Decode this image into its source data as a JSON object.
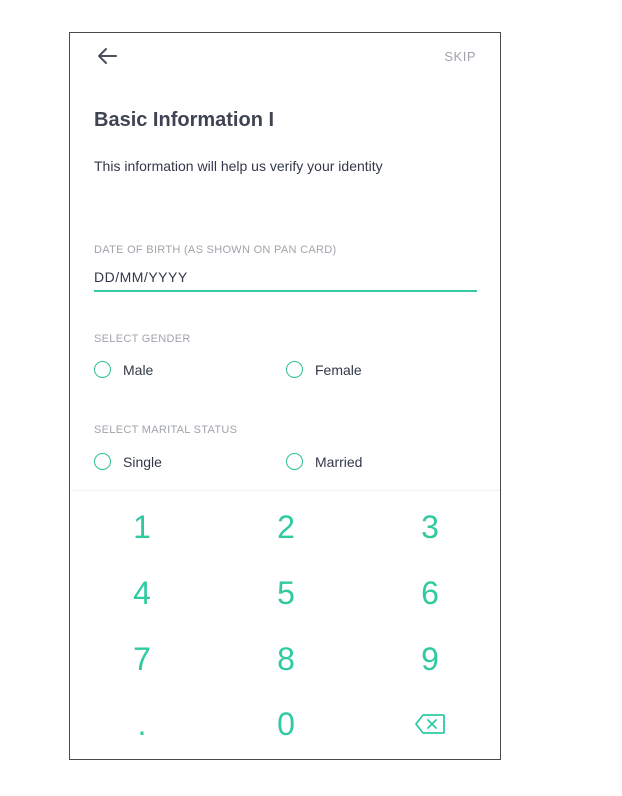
{
  "header": {
    "skip_label": "SKIP"
  },
  "page": {
    "title": "Basic Information I",
    "subtitle": "This information will help us verify your identity"
  },
  "dob": {
    "label": "DATE OF BIRTH (AS SHOWN ON PAN CARD)",
    "placeholder": "DD/MM/YYYY",
    "value": ""
  },
  "gender": {
    "label": "SELECT GENDER",
    "options": [
      "Male",
      "Female"
    ]
  },
  "marital": {
    "label": "SELECT MARITAL STATUS",
    "options": [
      "Single",
      "Married"
    ]
  },
  "keypad": {
    "keys": [
      "1",
      "2",
      "3",
      "4",
      "5",
      "6",
      "7",
      "8",
      "9",
      ".",
      "0"
    ],
    "backspace_icon": "backspace-icon"
  },
  "colors": {
    "accent": "#2fcaa0",
    "text": "#33394a",
    "muted": "#a0a4ab"
  }
}
